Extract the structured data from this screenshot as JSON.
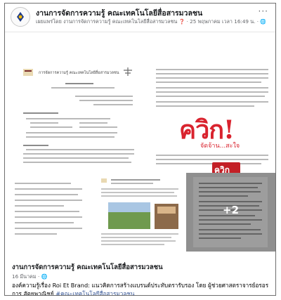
{
  "post": {
    "page_name": "งานการจัดการความรู้ คณะเทคโนโลยีสื่อสารมวลชน",
    "shared_by": "เผยแพร่โดย งานการจัดการความรู้ คณะเทคโนโลยีสื่อสารมวลชน",
    "meta_date": "25 พฤษภาคม เวลา 16:49 น.",
    "more_label": "···",
    "globe_icon": "globe-icon",
    "help_icon": "help-icon"
  },
  "gallery": {
    "more_count": "+2"
  },
  "main_image": {
    "left_doc_title": "การจัดการความรู้ คณะเทคโนโลยีสื่อสารมวลชน",
    "poster_big": "ควิก!",
    "poster_sub": "จัดจ้าน...สะใจ",
    "poster_small": "ควิก"
  },
  "caption": {
    "title": "งานการจัดการความรู้ คณะเทคโนโลยีสื่อสารมวลชน",
    "date": "16 มีนาคม",
    "text": "องค์ความรู้เรื่อง Roi Et Brand: แนวคิดการสร้างแบรนด์ประทับตรารับรอง โดย ผู้ช่วยศาสตราจารย์อรอร การ สัตยพาณิชย์",
    "hashtag": "#คณะเทคโนโลยีสื่อสารมวลชน"
  }
}
